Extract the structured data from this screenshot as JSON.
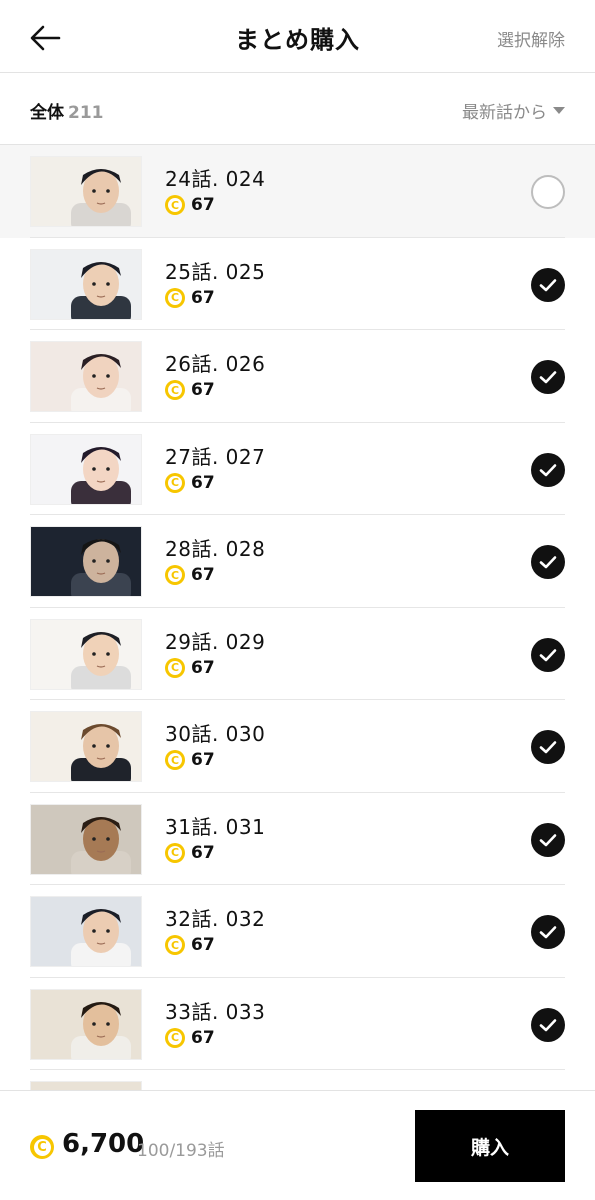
{
  "header": {
    "title": "まとめ購入",
    "deselect_label": "選択解除"
  },
  "subbar": {
    "total_label": "全体",
    "total_count": "211",
    "sort_label": "最新話から"
  },
  "episodes": [
    {
      "title": "24話. 024",
      "price": "67",
      "selected": false,
      "thumb": "man-leaning",
      "colors": {
        "bg": "#f2efe9",
        "skin": "#e9c9ae",
        "hair": "#1c1c22",
        "cloth": "#d9d6d2"
      }
    },
    {
      "title": "25話. 025",
      "price": "67",
      "selected": true,
      "thumb": "two-men",
      "colors": {
        "bg": "#eef0f2",
        "skin": "#edcfb5",
        "hair": "#1b1d26",
        "cloth": "#2f3640"
      }
    },
    {
      "title": "26話. 026",
      "price": "67",
      "selected": true,
      "thumb": "woman-hand-face",
      "colors": {
        "bg": "#f1e9e4",
        "skin": "#f0d3bf",
        "hair": "#2a1f24",
        "cloth": "#f5f2ef"
      }
    },
    {
      "title": "27話. 027",
      "price": "67",
      "selected": true,
      "thumb": "woman-bob",
      "colors": {
        "bg": "#f4f4f6",
        "skin": "#f3d6c4",
        "hair": "#231a2a",
        "cloth": "#3a2f3b"
      }
    },
    {
      "title": "28話. 028",
      "price": "67",
      "selected": true,
      "thumb": "man-dark-room",
      "colors": {
        "bg": "#1d2430",
        "skin": "#cdb39d",
        "hair": "#151515",
        "cloth": "#3b4350"
      }
    },
    {
      "title": "29話. 029",
      "price": "67",
      "selected": true,
      "thumb": "man-profile-hand",
      "colors": {
        "bg": "#f6f4f1",
        "skin": "#f0d2b8",
        "hair": "#1e1f25",
        "cloth": "#dcdcdc"
      }
    },
    {
      "title": "30話. 030",
      "price": "67",
      "selected": true,
      "thumb": "man-startled",
      "colors": {
        "bg": "#f3efe8",
        "skin": "#e6c5a8",
        "hair": "#6b4a2e",
        "cloth": "#1f232b"
      }
    },
    {
      "title": "31話. 031",
      "price": "67",
      "selected": true,
      "thumb": "man-crying",
      "colors": {
        "bg": "#cfc8bd",
        "skin": "#a67a55",
        "hair": "#2a1d14",
        "cloth": "#d7d0c6"
      }
    },
    {
      "title": "32話. 032",
      "price": "67",
      "selected": true,
      "thumb": "young-man-office",
      "colors": {
        "bg": "#dfe3e8",
        "skin": "#ecccb2",
        "hair": "#1b1e27",
        "cloth": "#f4f4f4"
      }
    },
    {
      "title": "33話. 033",
      "price": "67",
      "selected": true,
      "thumb": "man-sleeping",
      "colors": {
        "bg": "#e9e2d6",
        "skin": "#e3bf9c",
        "hair": "#241a12",
        "cloth": "#f0eee9"
      }
    }
  ],
  "footer": {
    "total_price": "6,700",
    "count_label": "100/193話",
    "buy_label": "購入"
  },
  "colors": {
    "coin": "#f7c600",
    "accent": "#000000",
    "muted_text": "#8a8a8a"
  }
}
